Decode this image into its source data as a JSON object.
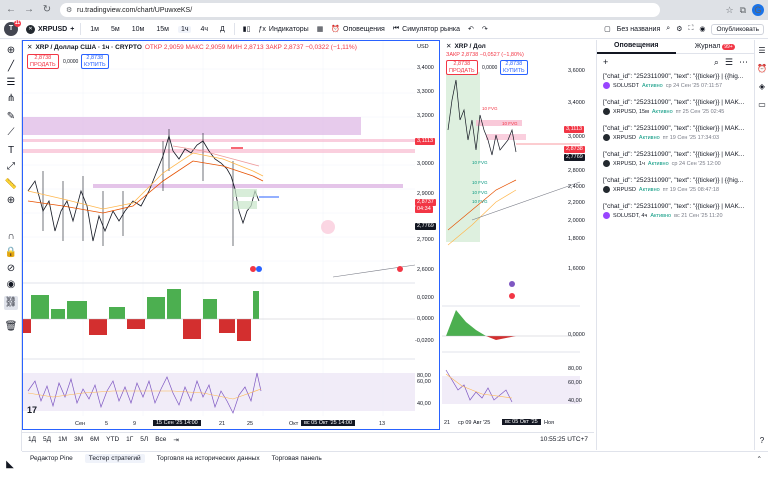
{
  "browser": {
    "url": "ru.tradingview.com/chart/UPuwxeKS/",
    "publish": "Опубликовать"
  },
  "toolbar": {
    "logo_badge": "11",
    "symbol": "XRPUSD",
    "timeframes": [
      "1м",
      "5м",
      "10м",
      "15м",
      "1ч",
      "4ч",
      "Д"
    ],
    "active_tf": "1ч",
    "indicators": "Индикаторы",
    "alerts": "Оповещения",
    "replay": "Симулятор рынка",
    "layout_name": "Без названия"
  },
  "main_chart": {
    "title": "XRP / Доллар США · 1ч · CRYPTO",
    "ohlc": "ОТКР 2,9059  МАКС 2,9059  МИН 2,8713  ЗАКР 2,8737  −0,0322 (−1,11%)",
    "currency": "USD",
    "sell_price": "2,8738",
    "sell_label": "ПРОДАТЬ",
    "buy_price": "2,8738",
    "buy_label": "КУПИТЬ",
    "spread": "0,0000",
    "price_levels": [
      "3,4000",
      "3,3000",
      "3,2000",
      "3,1000",
      "3,0000",
      "2,9000",
      "2,8000",
      "2,7000",
      "2,6000"
    ],
    "tag_top": "3,1113",
    "tag_current": "2,8737",
    "tag_countdown": "04:34",
    "tag_low": "2,7769",
    "osc_levels": [
      "0,0200",
      "0,0000",
      "-0,0200"
    ],
    "rsi_levels": [
      "80,00",
      "60,00",
      "40,00"
    ],
    "time_labels": [
      "Сен",
      "5",
      "9",
      "15 Сен '25  14:00",
      "21",
      "25",
      "Окт",
      "13"
    ],
    "time_highlight": "вс 05 Окт '25  14:00"
  },
  "right_chart": {
    "title": "XRP / Дол",
    "ohlc": "ЗАКР 2,8738  −0,0527 (−1,80%)",
    "sell_price": "2,8738",
    "sell_label": "ПРОДАТЬ",
    "buy_price": "2,8738",
    "buy_label": "КУПИТЬ",
    "spread": "0,0000",
    "price_levels": [
      "3,6000",
      "3,4000",
      "3,2000",
      "3,0000",
      "2,8000",
      "2,6000",
      "2,4000",
      "2,2000",
      "2,0000",
      "1,8000",
      "1,6000"
    ],
    "tag_top": "3,1113",
    "tag_current": "2,8738",
    "tag_low": "2,7769",
    "fvg_labels": [
      "10 FVG",
      "10 FVG",
      "10 FVG",
      "10 FVG",
      "10 FVG",
      "10 FVG"
    ],
    "osc_levels": [
      "0,0000"
    ],
    "rsi_levels": [
      "80,00",
      "60,00",
      "40,00"
    ],
    "time_labels": [
      "21",
      "ср 09 Авг '25",
      "вс 05 Окт '25",
      "Ноя"
    ]
  },
  "range_bar": {
    "ranges": [
      "1Д",
      "5Д",
      "1М",
      "3М",
      "6М",
      "YTD",
      "1Г",
      "5Л",
      "Все"
    ],
    "clock": "10:55:25 UTC+7"
  },
  "bottom_tabs": [
    "Редактор Pine",
    "Тестер стратегий",
    "Торговля на исторических данных",
    "Торговая панель"
  ],
  "sidebar": {
    "tab_alerts": "Оповещения",
    "tab_journal": "Журнал",
    "journal_badge": "99+",
    "alerts": [
      {
        "text": "[\"chat_id\": \"252311090\", \"text\": \"{{ticker}} | {{hig...",
        "symbol": "SOLUSDT",
        "status": "Активно",
        "date": "ср 24 Сен '25  07:11:57",
        "color": "#9945ff"
      },
      {
        "text": "[\"chat_id\": \"252311090\", \"text\": \"{{ticker}} | MAK...",
        "symbol": "XRPUSD, 15м",
        "status": "Активно",
        "date": "пт 25 Сен '25  02:45",
        "color": "#23292f"
      },
      {
        "text": "[\"chat_id\": \"252311090\", \"text\": \"{{ticker}} | MAK...",
        "symbol": "XRPUSD",
        "status": "Активно",
        "date": "пт 19 Сен '25  17:34:03",
        "color": "#23292f"
      },
      {
        "text": "[\"chat_id\": \"252311090\", \"text\": \"{{ticker}} | MAK...",
        "symbol": "XRPUSD, 1ч",
        "status": "Активно",
        "date": "ср 24 Сен '25  12:00",
        "color": "#23292f"
      },
      {
        "text": "[\"chat_id\": \"252311090\", \"text\": \"{{ticker}} | {{hig...",
        "symbol": "XRPUSD",
        "status": "Активно",
        "date": "пт 19 Сен '25  08:47:18",
        "color": "#23292f"
      },
      {
        "text": "[\"chat_id\": \"252311090\", \"text\": \"{{ticker}} | MAK...",
        "symbol": "SOLUSDT, 4ч",
        "status": "Активно",
        "date": "вс 21 Сен '25  11:20",
        "color": "#9945ff"
      }
    ]
  },
  "colors": {
    "accent": "#2962ff",
    "down": "#f23645",
    "up": "#089981",
    "zone": "#e1bee7"
  }
}
